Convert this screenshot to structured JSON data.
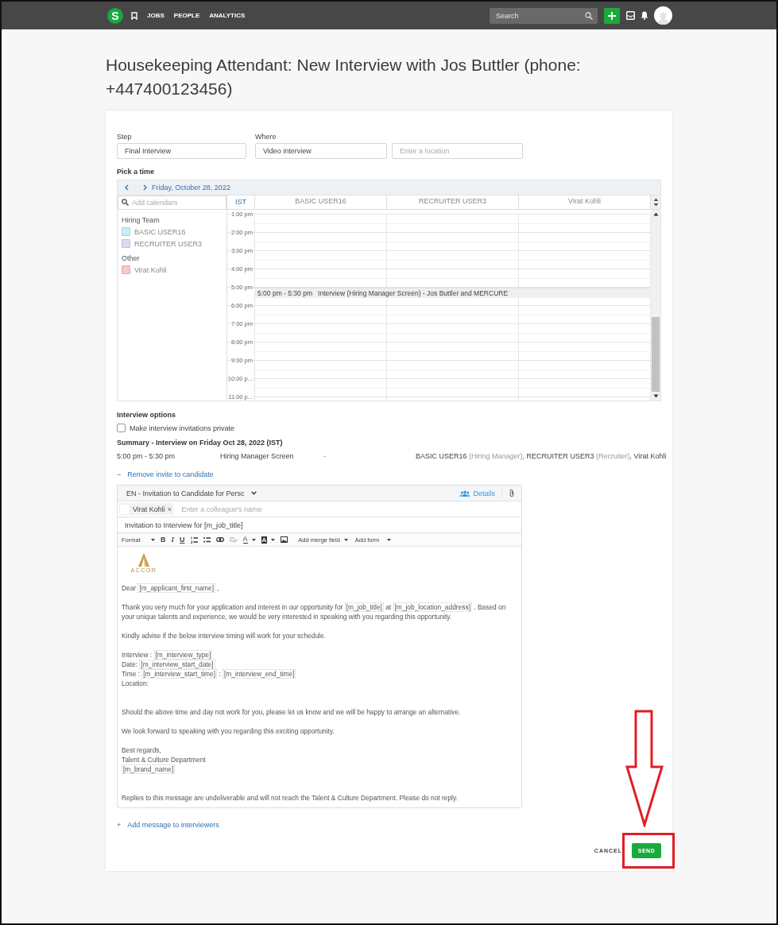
{
  "topbar": {
    "logo": "S",
    "nav": [
      {
        "label": "JOBS"
      },
      {
        "label": "PEOPLE"
      },
      {
        "label": "ANALYTICS"
      }
    ],
    "search": {
      "placeholder": "Search"
    }
  },
  "title": "Housekeeping Attendant: New Interview with Jos Buttler (phone: +447400123456)",
  "step": {
    "label": "Step",
    "value": "Final Interview"
  },
  "where": {
    "label": "Where",
    "value": "Video interview",
    "location_placeholder": "Enter a location"
  },
  "pick_time": {
    "label": "Pick a time",
    "date": "Friday, October 28, 2022",
    "calendar_search_placeholder": "Add calendars",
    "groups": [
      {
        "name": "Hiring Team",
        "calendars": [
          {
            "name": "BASIC USER16",
            "color": "#c6eef9"
          },
          {
            "name": "RECRUITER USER3",
            "color": "#e4d6f5"
          }
        ]
      },
      {
        "name": "Other",
        "calendars": [
          {
            "name": "Virat Kohli",
            "color": "#f5c9c9"
          }
        ]
      }
    ],
    "timezone": "IST",
    "columns": [
      "BASIC USER16",
      "RECRUITER USER3",
      "Virat Kohli"
    ],
    "hours": [
      {
        "label": "1:00 pm"
      },
      {
        "label": "2:00 pm"
      },
      {
        "label": "3:00 pm"
      },
      {
        "label": "4:00 pm"
      },
      {
        "label": "5:00 pm",
        "event": {
          "time": "5:00 pm - 5:30 pm",
          "title": "Interview (Hiring Manager Screen) - Jos Buttler and MERCURE"
        }
      },
      {
        "label": "6:00 pm"
      },
      {
        "label": "7:00 pm"
      },
      {
        "label": "8:00 pm"
      },
      {
        "label": "9:00 pm"
      },
      {
        "label": "10:00 p..."
      },
      {
        "label": "11:00 p..."
      }
    ]
  },
  "options": {
    "label": "Interview options",
    "private": {
      "label": "Make interview invitations private",
      "checked": false
    }
  },
  "summary": {
    "title": "Summary - Interview on Friday Oct 28, 2022 (IST)",
    "time": "5:00 pm - 5:30 pm",
    "type": "Hiring Manager Screen",
    "location": "-",
    "attendees": [
      {
        "text": "BASIC USER16 ",
        "kind": "name"
      },
      {
        "text": "(Hiring Manager)",
        "kind": "role"
      },
      {
        "text": ", RECRUITER USER3 ",
        "kind": "name"
      },
      {
        "text": "(Recruiter)",
        "kind": "role"
      },
      {
        "text": ", Virat Kohli",
        "kind": "name"
      }
    ]
  },
  "remove_invite": {
    "icon": "−",
    "label": "Remove invite to candidate"
  },
  "email": {
    "template": "EN - Invitation to Candidate for Persc",
    "details": "Details",
    "recipients": [
      {
        "name": "Virat Kohli",
        "remove": "×"
      }
    ],
    "recipient_placeholder": "Enter a colleague's name",
    "subject": "Invitation to Interview for [m_job_title]",
    "toolbar": {
      "format": "Format",
      "bold": "B",
      "italic": "I",
      "underline": "U",
      "text_color": "A",
      "bg_color": "A",
      "merge": "Add merge field",
      "form": "Add form"
    },
    "logo_text": "ACCOR",
    "body": [
      {
        "lines": [
          [
            "Dear ",
            {
              "field": "[m_applicant_first_name]"
            },
            " ,"
          ]
        ]
      },
      {
        "lines": [
          [
            "Thank you very much for your application and interest in our opportunity for ",
            {
              "field": "[m_job_title]"
            },
            " at ",
            {
              "field": "[m_job_location_address]"
            },
            " . Based on your unique talents and experience, we would be very interested in speaking with you regarding this opportunity."
          ]
        ]
      },
      {
        "lines": [
          [
            "Kindly advise if the below interview timing will work for your schedule."
          ]
        ]
      },
      {
        "lines": [
          [
            "Interview : ",
            {
              "field": "[m_interview_type]"
            }
          ],
          [
            "Date: ",
            {
              "field": "[m_interview_start_date]"
            }
          ],
          [
            "Time : ",
            {
              "field": "[m_interview_start_time]"
            },
            " : ",
            {
              "field": "[m_interview_end_time]"
            }
          ],
          [
            "Location:"
          ]
        ]
      },
      {
        "lines": [
          [
            "Should the above time and day not work for you, please let us know and we will be happy to arrange an alternative."
          ]
        ],
        "space_before": true
      },
      {
        "lines": [
          [
            "We look forward to speaking with you regarding this exciting opportunity."
          ]
        ]
      },
      {
        "lines": [
          [
            "Best regards,"
          ],
          [
            "Talent & Culture Department"
          ],
          [
            {
              "field": "[m_brand_name]"
            }
          ]
        ]
      },
      {
        "lines": [
          [
            "Replies to this message are undeliverable and will not reach the Talent & Culture Department. Please do not reply."
          ]
        ],
        "space_before": true
      }
    ]
  },
  "add_message": {
    "icon": "+",
    "label": "Add message to interviewers"
  },
  "actions": {
    "cancel": "CANCEL",
    "send": "SEND"
  }
}
